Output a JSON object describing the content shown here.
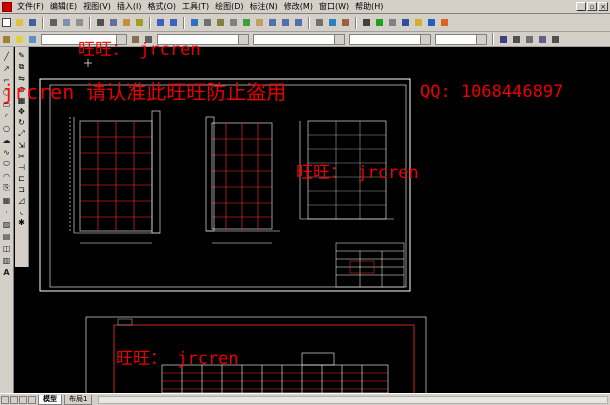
{
  "menu": {
    "items": [
      "文件(F)",
      "编辑(E)",
      "视图(V)",
      "插入(I)",
      "格式(O)",
      "工具(T)",
      "绘图(D)",
      "标注(N)",
      "修改(M)",
      "窗口(W)",
      "帮助(H)"
    ]
  },
  "statusbar": {
    "tabs": [
      "模型",
      "布局1"
    ]
  },
  "watermarks": {
    "line1": "旺旺：  jrcren",
    "line2": "jrcren  请认准此旺旺防止盗用",
    "qq": "QQ:    1068446897",
    "line3": "旺旺：  jrcren",
    "line4": "旺旺：  jrcren"
  },
  "colors": {
    "accent_red": "#ff0000",
    "cad_background": "#000000",
    "ui_face": "#d4d0c8"
  },
  "icons": {
    "left_toolbar": [
      "line-icon",
      "ray-icon",
      "polyline-icon",
      "polygon-icon",
      "rectangle-icon",
      "arc-icon",
      "circle-icon",
      "revcloud-icon",
      "spline-icon",
      "ellipse-icon",
      "insert-block-icon",
      "make-block-icon",
      "point-icon",
      "hatch-icon",
      "region-icon",
      "text-icon"
    ]
  }
}
